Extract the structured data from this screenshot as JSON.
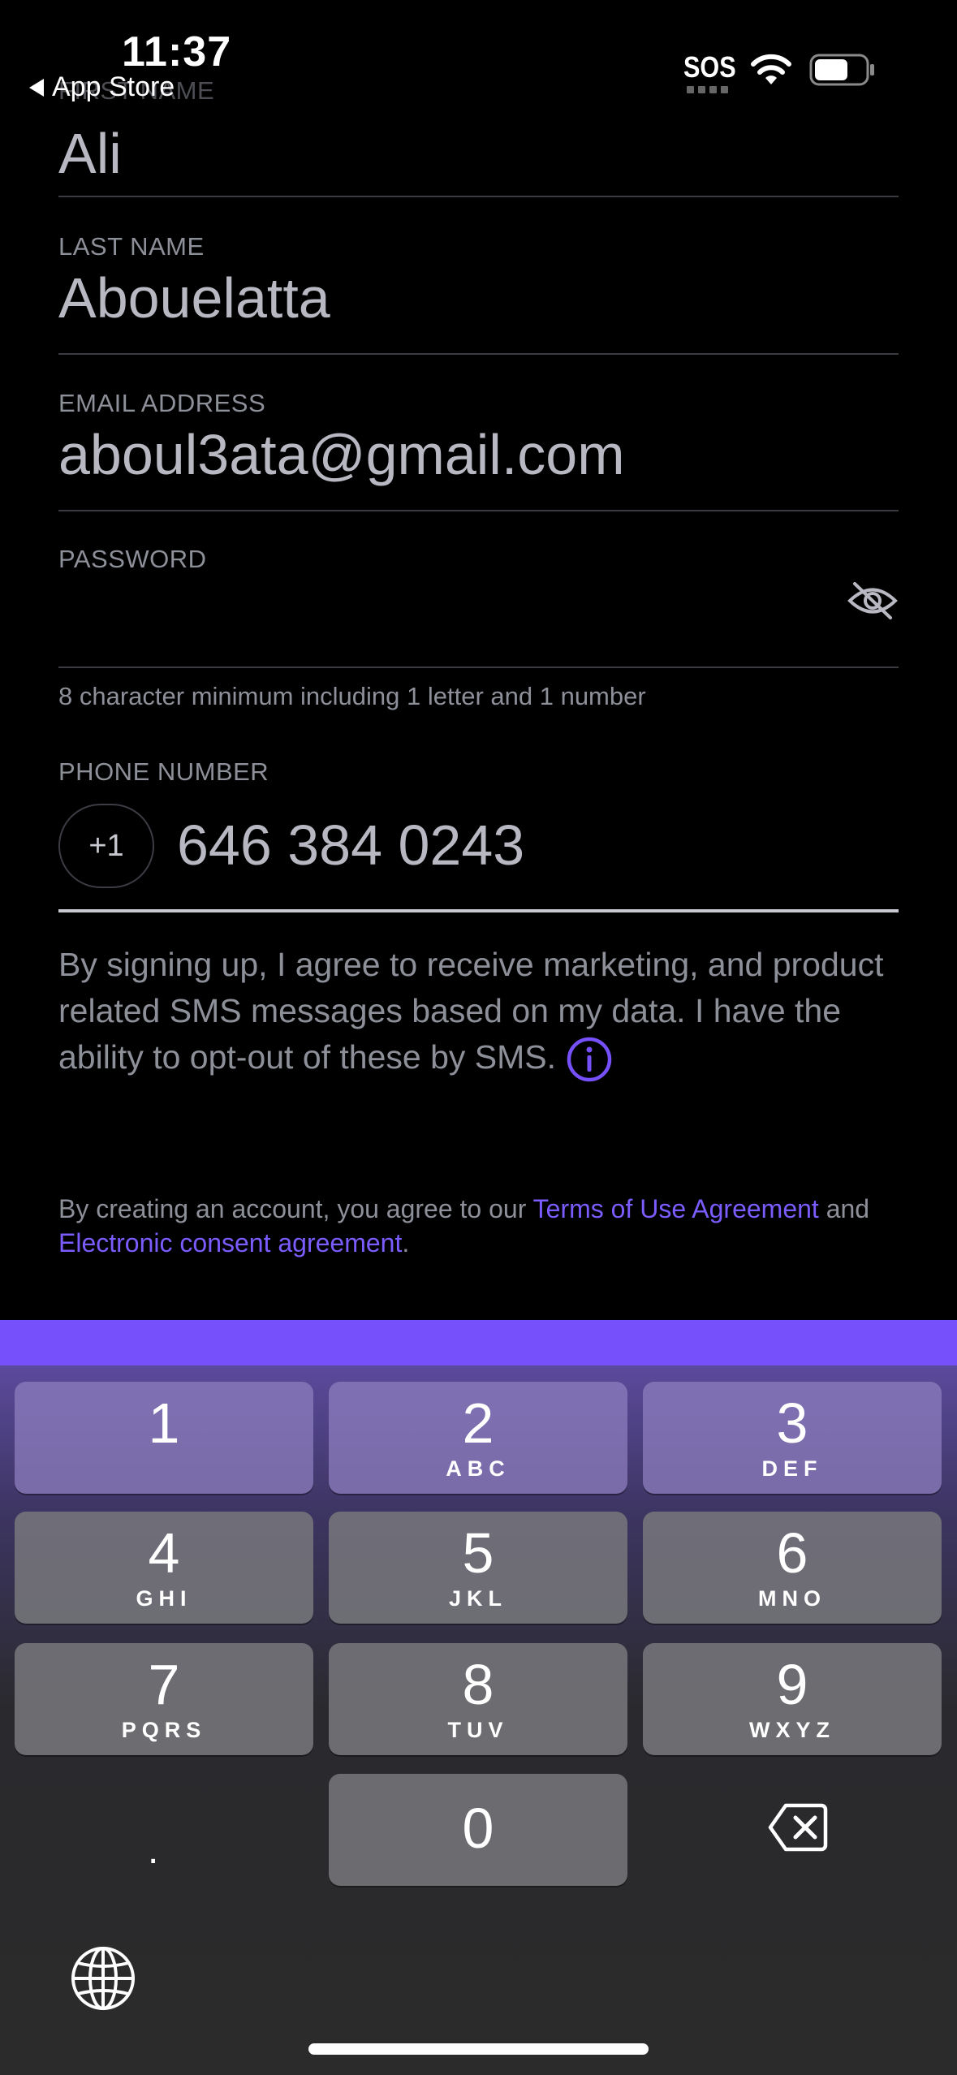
{
  "status_bar": {
    "time": "11:37",
    "back_label": "App Store",
    "sos": "SOS"
  },
  "form": {
    "first_name": {
      "label": "FIRST NAME",
      "value": "Ali"
    },
    "last_name": {
      "label": "LAST NAME",
      "value": "Abouelatta"
    },
    "email": {
      "label": "EMAIL ADDRESS",
      "value": "aboul3ata@gmail.com"
    },
    "password": {
      "label": "PASSWORD",
      "value": "",
      "hint": "8 character minimum including 1 letter and 1 number"
    },
    "phone": {
      "label": "PHONE NUMBER",
      "country_code": "+1",
      "value": "646 384 0243"
    },
    "sms_consent": "By signing up, I agree to receive marketing, and product related SMS messages based on my data. I have the ability to opt-out of these by SMS.",
    "terms": {
      "prefix": "By creating an account, you agree to our ",
      "terms_link": "Terms of Use Agreement",
      "middle": " and",
      "consent_link": "Electronic consent agreement",
      "suffix": "."
    }
  },
  "keyboard": {
    "keys": [
      {
        "num": "1",
        "letters": ""
      },
      {
        "num": "2",
        "letters": "ABC"
      },
      {
        "num": "3",
        "letters": "DEF"
      },
      {
        "num": "4",
        "letters": "GHI"
      },
      {
        "num": "5",
        "letters": "JKL"
      },
      {
        "num": "6",
        "letters": "MNO"
      },
      {
        "num": "7",
        "letters": "PQRS"
      },
      {
        "num": "8",
        "letters": "TUV"
      },
      {
        "num": "9",
        "letters": "WXYZ"
      },
      {
        "num": "0",
        "letters": ""
      }
    ],
    "dot": ".",
    "icons": {
      "backspace": "backspace-icon",
      "globe": "globe-icon"
    }
  },
  "colors": {
    "accent": "#7650fb",
    "link": "#7b5cff",
    "label": "#8d8f99",
    "value": "#b7b8c2"
  }
}
